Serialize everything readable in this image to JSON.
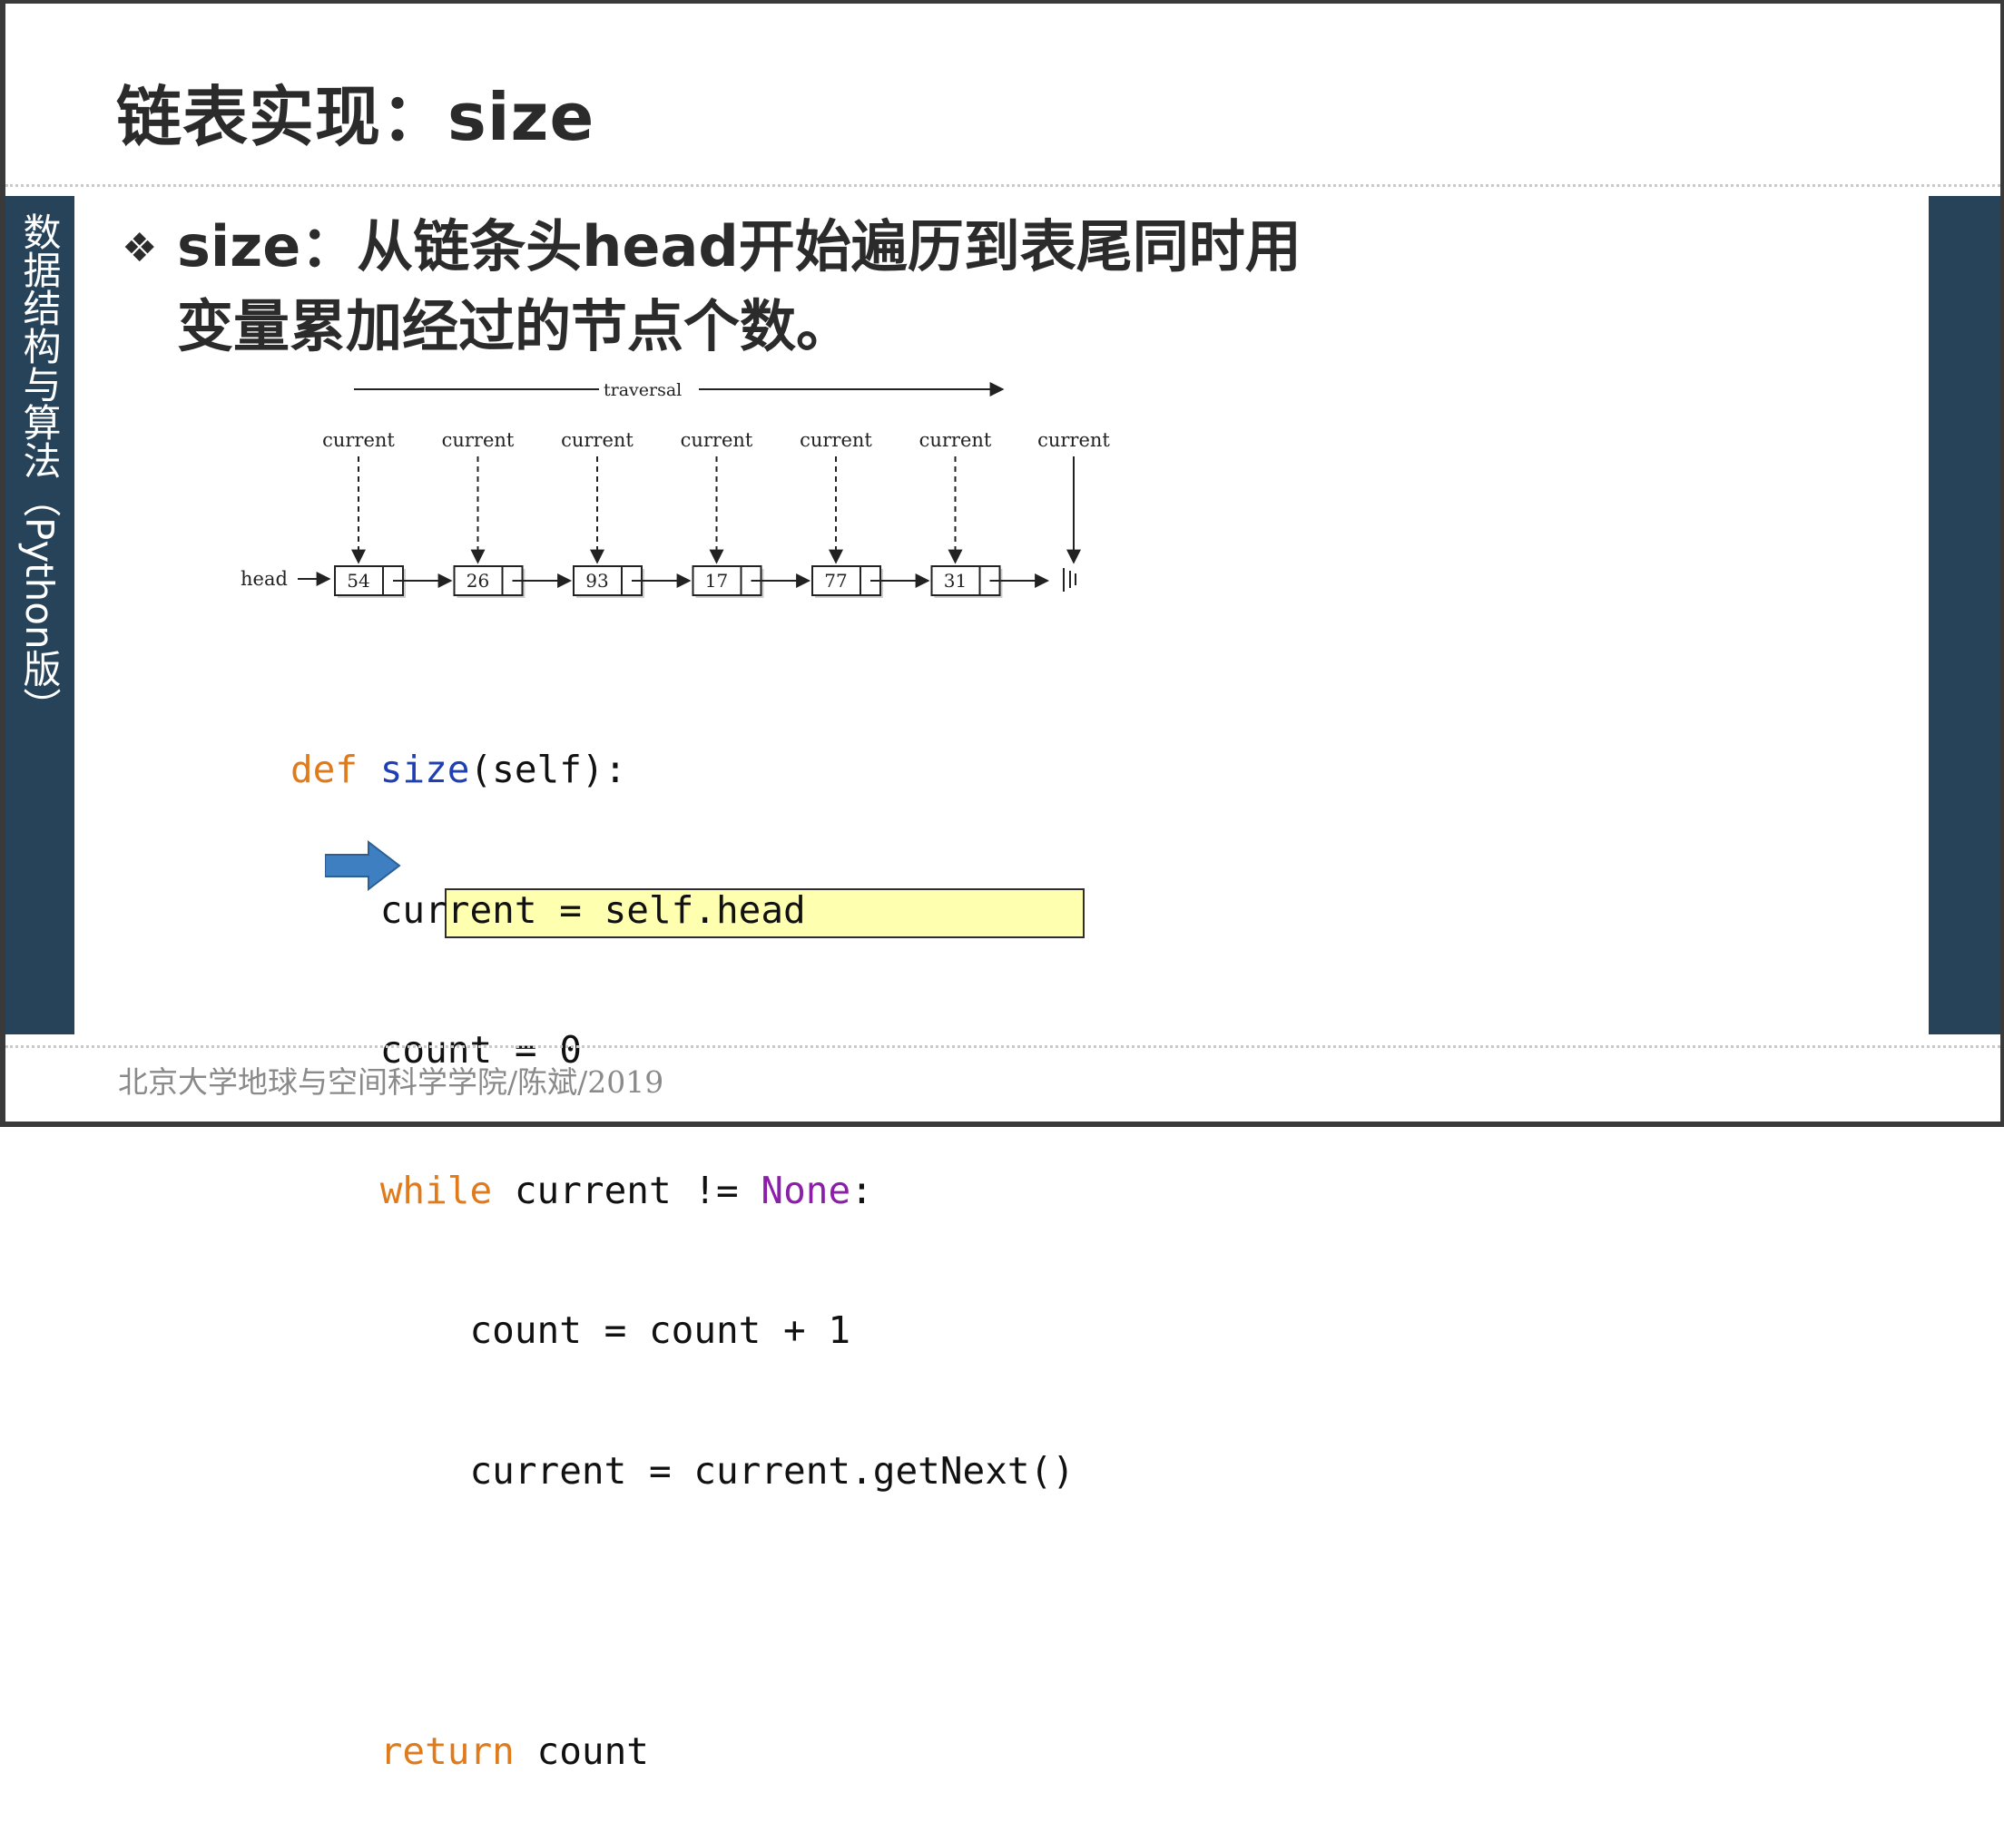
{
  "slide": {
    "title": "链表实现：size",
    "side_label": "数据结构与算法（Python版）",
    "bullet_text": "size：从链条头head开始遍历到表尾同时用变量累加经过的节点个数。",
    "footer": "北京大学地球与空间科学学院/陈斌/2019"
  },
  "diagram": {
    "traversal_label": "traversal",
    "head_label": "head",
    "current_label": "current",
    "nodes": [
      "54",
      "26",
      "93",
      "17",
      "77",
      "31"
    ]
  },
  "code": {
    "line1": {
      "kw": "def",
      "fn": "size",
      "rest": "(self):"
    },
    "line2": "    current = self.head",
    "line3": "    count = 0",
    "line4": {
      "kw": "while",
      "mid": " current != ",
      "none": "None",
      "end": ":"
    },
    "line5": "        count = count + 1",
    "line6": "        current = current.getNext()",
    "line7": {
      "kw": "return",
      "rest": " count"
    }
  },
  "colors": {
    "sidebar": "#27435a",
    "keyword": "#e07b1c",
    "function": "#1f3fb3",
    "none_const": "#8b1fa8",
    "highlight": "#ffffb0",
    "pointer_arrow": "#3d7fc1"
  },
  "icons": {
    "bullet": "diamond-bullet-icon",
    "pointer": "right-arrow-icon"
  }
}
